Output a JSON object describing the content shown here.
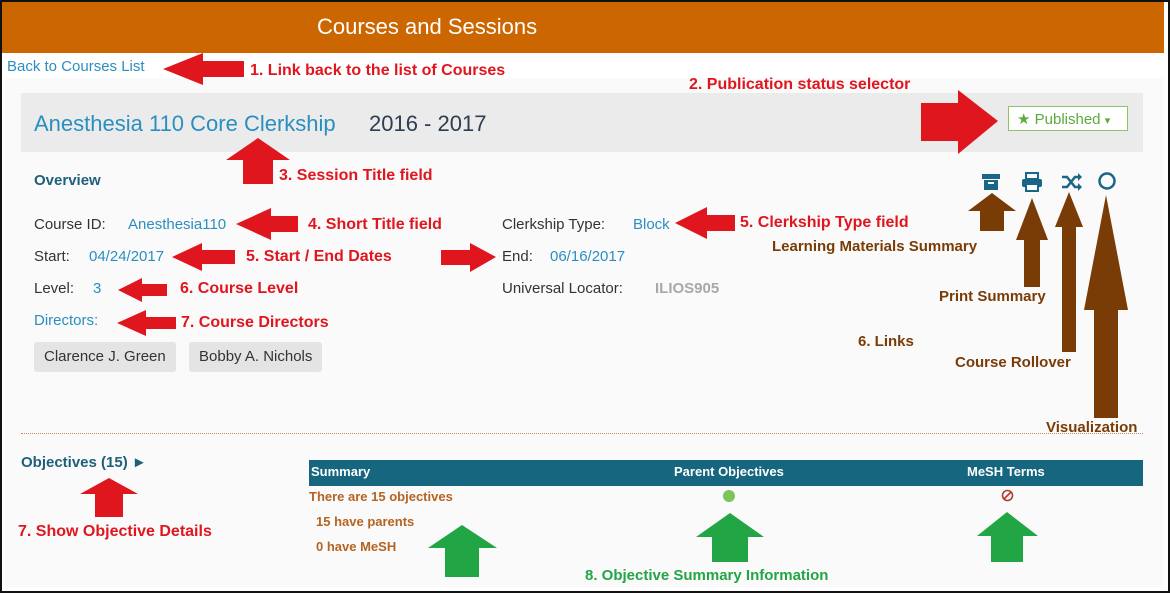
{
  "header": {
    "title": "Courses and Sessions"
  },
  "back_link": "Back to Courses List",
  "course": {
    "title": "Anesthesia 110 Core Clerkship",
    "year": "2016 - 2017",
    "overview_label": "Overview",
    "course_id_label": "Course ID:",
    "course_id": "Anesthesia110",
    "clerkship_label": "Clerkship Type:",
    "clerkship": "Block",
    "start_label": "Start:",
    "start": "04/24/2017",
    "end_label": "End:",
    "end": "06/16/2017",
    "level_label": "Level:",
    "level": "3",
    "locator_label": "Universal Locator:",
    "locator": "ILIOS905",
    "directors_label": "Directors:",
    "directors": [
      "Clarence J. Green",
      "Bobby A. Nichols"
    ]
  },
  "publication": {
    "status": "Published",
    "caret": "▾",
    "star": "★"
  },
  "objectives": {
    "toggle": "Objectives (15) ►",
    "columns": [
      "Summary",
      "Parent Objectives",
      "MeSH Terms"
    ],
    "summary": "There are 15 objectives",
    "parents": "15 have parents",
    "mesh": "0 have MeSH"
  },
  "annotations": {
    "a1": "1. Link back to the list of Courses",
    "a2": "2. Publication status selector",
    "a3": "3. Session Title field",
    "a4": "4. Short Title field",
    "a5": "5. Clerkship Type field",
    "a5b": "5. Start / End Dates",
    "a6": "6. Course Level",
    "a7": "7. Course Directors",
    "a7b": "7. Show Objective Details",
    "a8": "8. Objective Summary Information",
    "lm": "Learning Materials Summary",
    "print": "Print Summary",
    "links": "6. Links",
    "rollover": "Course Rollover",
    "vis": "Visualization"
  },
  "icons": [
    "archive-icon",
    "print-icon",
    "shuffle-icon",
    "circle-icon"
  ],
  "colors": {
    "header": "#cc6600",
    "accent": "#2a8fc0",
    "annotation": "#e0161f",
    "published": "#5bab3d"
  }
}
